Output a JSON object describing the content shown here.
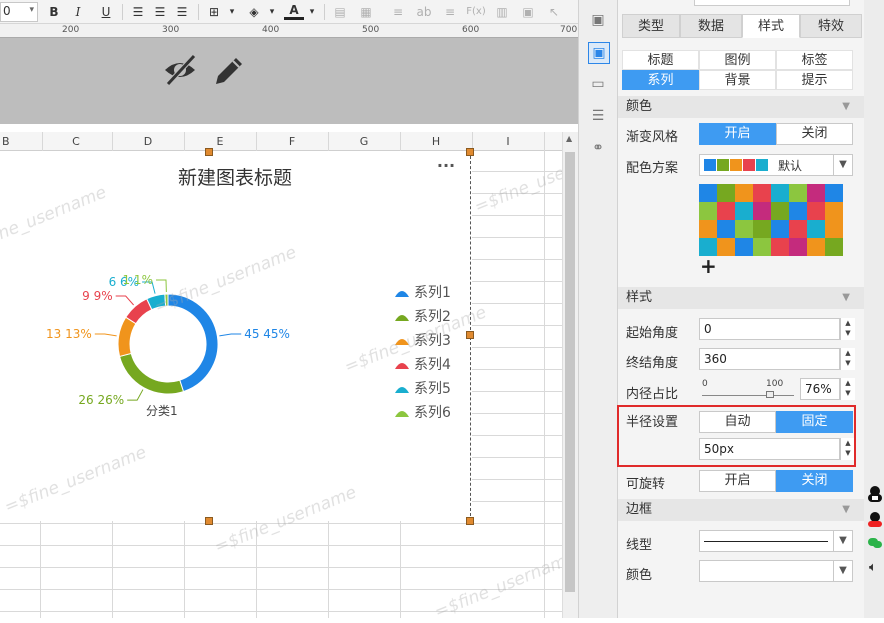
{
  "toolbar": {
    "font_size_value": "0",
    "bold": "B",
    "italic": "I",
    "underline": "U",
    "ab_label": "ab",
    "fx_label": "F(x)"
  },
  "ruler": {
    "marks": [
      "200",
      "300",
      "400",
      "500",
      "600",
      "700"
    ]
  },
  "columns": [
    "B",
    "C",
    "D",
    "E",
    "F",
    "G",
    "H",
    "I"
  ],
  "watermark": "=$fine_username",
  "chart_data": {
    "type": "pie",
    "title": "新建图表标题",
    "category": "分类1",
    "inner_radius_percent": 76,
    "start_angle": 0,
    "end_angle": 360,
    "series": [
      {
        "name": "系列1",
        "value": 45,
        "label": "45  45%",
        "color": "#1f86e6"
      },
      {
        "name": "系列2",
        "value": 26,
        "label": "26  26%",
        "color": "#76a820"
      },
      {
        "name": "系列3",
        "value": 13,
        "label": "13  13%",
        "color": "#f0941c"
      },
      {
        "name": "系列4",
        "value": 9,
        "label": "9  9%",
        "color": "#e8424d"
      },
      {
        "name": "系列5",
        "value": 6,
        "label": "6  6%",
        "color": "#19aecf"
      },
      {
        "name": "系列6",
        "value": 1,
        "label": "1  1%",
        "color": "#8cc63f"
      }
    ],
    "legend_position": "right"
  },
  "panel": {
    "tabs": [
      "类型",
      "数据",
      "样式",
      "特效"
    ],
    "active_tab": "样式",
    "style_tabs_row1": [
      "标题",
      "图例",
      "标签"
    ],
    "style_tabs_row2": [
      "系列",
      "背景",
      "提示"
    ],
    "active_style_tab": "系列",
    "color_section": "颜色",
    "gradient_label": "渐变风格",
    "on_label": "开启",
    "off_label": "关闭",
    "scheme_label": "配色方案",
    "scheme_value": "默认",
    "palette": [
      "#1f86e6",
      "#76a820",
      "#f0941c",
      "#e8424d",
      "#19aecf",
      "#8cc63f",
      "#c42b7d",
      "#1f86e6",
      "#e8424d"
    ],
    "add_symbol": "+",
    "style_section": "样式",
    "start_angle_label": "起始角度",
    "start_angle_value": "0",
    "end_angle_label": "终结角度",
    "end_angle_value": "360",
    "inner_ratio_label": "内径占比",
    "slider_min": "0",
    "slider_max": "100",
    "inner_ratio_value": "76%",
    "radius_label": "半径设置",
    "auto_label": "自动",
    "fixed_label": "固定",
    "radius_value": "50px",
    "rotatable_label": "可旋转",
    "border_section": "边框",
    "line_type_label": "线型",
    "border_color_label": "颜色"
  }
}
